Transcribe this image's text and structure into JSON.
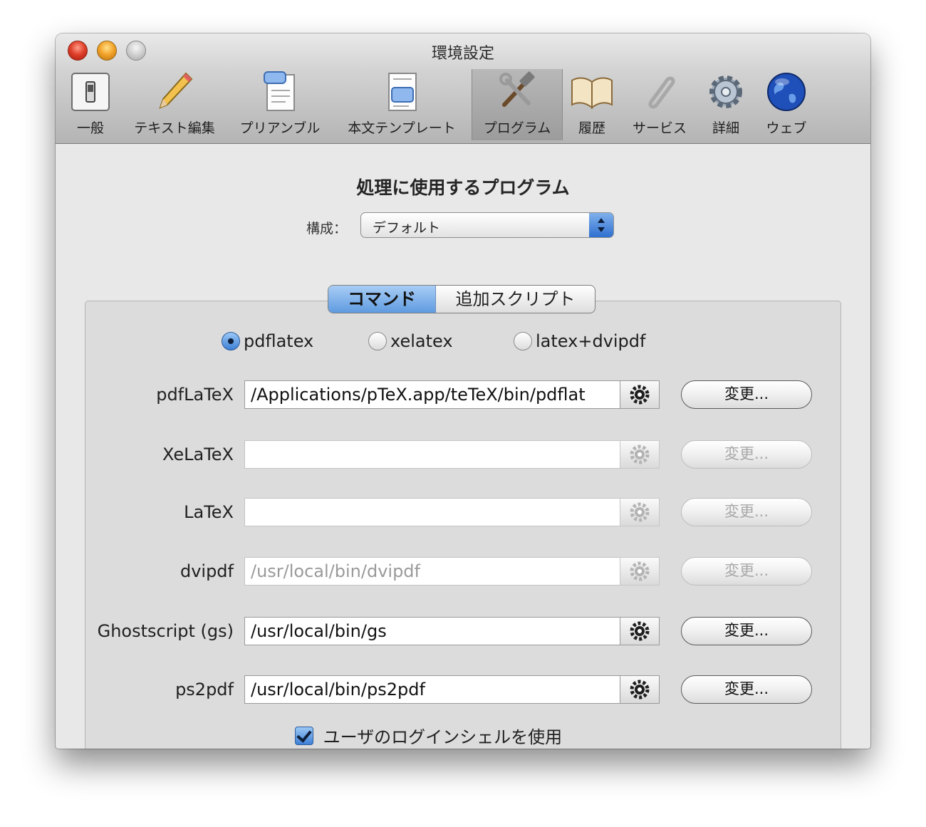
{
  "window": {
    "title": "環境設定"
  },
  "toolbar": {
    "items": [
      {
        "label": "一般",
        "icon": "general-switch-icon"
      },
      {
        "label": "テキスト編集",
        "icon": "pencil-icon"
      },
      {
        "label": "プリアンブル",
        "icon": "preamble-document-icon"
      },
      {
        "label": "本文テンプレート",
        "icon": "template-document-icon"
      },
      {
        "label": "プログラム",
        "icon": "tools-icon",
        "selected": true
      },
      {
        "label": "履歴",
        "icon": "open-book-icon"
      },
      {
        "label": "サービス",
        "icon": "paperclip-icon"
      },
      {
        "label": "詳細",
        "icon": "gear-icon"
      },
      {
        "label": "ウェブ",
        "icon": "globe-icon"
      }
    ]
  },
  "main": {
    "section_title": "処理に使用するプログラム",
    "config_label": "構成：",
    "config_value": "デフォルト",
    "tabs": [
      {
        "label": "コマンド",
        "selected": true
      },
      {
        "label": "追加スクリプト",
        "selected": false
      }
    ],
    "radios": [
      {
        "label": "pdflatex",
        "checked": true
      },
      {
        "label": "xelatex",
        "checked": false
      },
      {
        "label": "latex+dvipdf",
        "checked": false
      }
    ],
    "programs": [
      {
        "label": "pdfLaTeX",
        "path": "/Applications/pTeX.app/teTeX/bin/pdflat",
        "enabled": true
      },
      {
        "label": "XeLaTeX",
        "path": "",
        "enabled": false
      },
      {
        "label": "LaTeX",
        "path": "",
        "enabled": false
      },
      {
        "label": "dvipdf",
        "path": "/usr/local/bin/dvipdf",
        "enabled": false
      },
      {
        "label": "Ghostscript (gs)",
        "path": "/usr/local/bin/gs",
        "enabled": true
      },
      {
        "label": "ps2pdf",
        "path": "/usr/local/bin/ps2pdf",
        "enabled": true
      }
    ],
    "change_label": "変更...",
    "login_shell_checkbox": {
      "label": "ユーザのログインシェルを使用",
      "checked": true
    }
  },
  "colors": {
    "accent_blue": "#3e7fd6",
    "close_red": "#e0412c",
    "minimize_yellow": "#f3a52c"
  }
}
